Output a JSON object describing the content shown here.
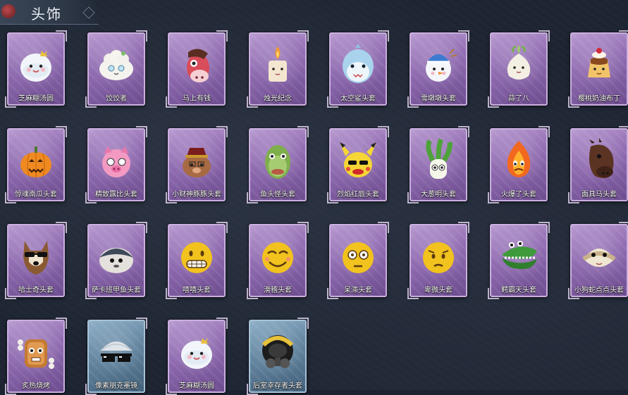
{
  "header": {
    "title": "头饰"
  },
  "items": [
    {
      "label": "芝麻糊汤圆",
      "frame": "purple",
      "icon": "tangyuan-icon"
    },
    {
      "label": "饺饺者",
      "frame": "purple",
      "icon": "dumpling-icon"
    },
    {
      "label": "马上有钱",
      "frame": "purple",
      "icon": "horse-icon"
    },
    {
      "label": "烛光纪念",
      "frame": "purple",
      "icon": "candle-icon"
    },
    {
      "label": "太空鲨头套",
      "frame": "purple",
      "icon": "shark-icon"
    },
    {
      "label": "雪墩墩头套",
      "frame": "purple",
      "icon": "snowman-icon"
    },
    {
      "label": "蒜了八",
      "frame": "purple",
      "icon": "garlic-icon"
    },
    {
      "label": "樱桃奶油布丁",
      "frame": "purple",
      "icon": "pudding-icon"
    },
    {
      "label": "惊魂南瓜头套",
      "frame": "purple",
      "icon": "pumpkin-icon"
    },
    {
      "label": "精致露比头套",
      "frame": "purple",
      "icon": "pig-icon"
    },
    {
      "label": "小财神豚豚头套",
      "frame": "purple",
      "icon": "piggy-god-icon"
    },
    {
      "label": "鱼头怪头套",
      "frame": "purple",
      "icon": "fish-head-icon"
    },
    {
      "label": "烈焰红唇头套",
      "frame": "purple",
      "icon": "pikachu-icon"
    },
    {
      "label": "大葱明头套",
      "frame": "purple",
      "icon": "scallion-icon"
    },
    {
      "label": "火爆了头套",
      "frame": "purple",
      "icon": "fire-icon"
    },
    {
      "label": "面具马头套",
      "frame": "purple",
      "icon": "horse-mask-icon"
    },
    {
      "label": "哈士奇头套",
      "frame": "purple",
      "icon": "husky-icon"
    },
    {
      "label": "萨卡班甲鱼头套",
      "frame": "purple",
      "icon": "sacabambaspis-icon"
    },
    {
      "label": "嘻嘻头套",
      "frame": "purple",
      "icon": "grin-emoji-icon"
    },
    {
      "label": "滑稽头套",
      "frame": "purple",
      "icon": "funny-emoji-icon"
    },
    {
      "label": "呆滞头套",
      "frame": "purple",
      "icon": "stare-emoji-icon"
    },
    {
      "label": "卑微头套",
      "frame": "purple",
      "icon": "humble-emoji-icon"
    },
    {
      "label": "鳄霸天头套",
      "frame": "purple",
      "icon": "crocodile-icon"
    },
    {
      "label": "小狗蛇点点头套",
      "frame": "purple",
      "icon": "snake-icon"
    },
    {
      "label": "炙热烧烤",
      "frame": "purple",
      "icon": "grill-icon"
    },
    {
      "label": "像素朋克墨镜",
      "frame": "blue",
      "icon": "pixel-glasses-icon"
    },
    {
      "label": "芝麻糊汤圆",
      "frame": "purple",
      "icon": "tangyuan-icon"
    },
    {
      "label": "后室幸存者头套",
      "frame": "blue",
      "icon": "gas-mask-icon"
    }
  ]
}
